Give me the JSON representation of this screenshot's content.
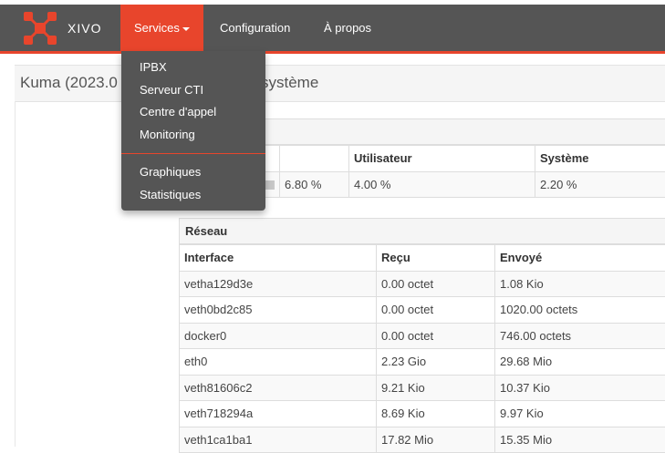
{
  "brand": {
    "name": "XIVO",
    "accent": "#e8452c",
    "navbar_bg": "#555555"
  },
  "nav": {
    "services": "Services",
    "configuration": "Configuration",
    "about": "À propos"
  },
  "dropdown": {
    "items": [
      "IPBX",
      "Serveur CTI",
      "Centre d'appel",
      "Monitoring"
    ],
    "items2": [
      "Graphiques",
      "Statistiques"
    ]
  },
  "page": {
    "title": "Kuma (2023.0",
    "title_tail": "système"
  },
  "cpu": {
    "headers": [
      "",
      "",
      "Utilisateur",
      "Système"
    ],
    "row": {
      "total": "6.80 %",
      "user": "4.00 %",
      "system": "2.20 %",
      "usage_fraction": 0.068
    }
  },
  "network": {
    "title": "Réseau",
    "headers": [
      "Interface",
      "Reçu",
      "Envoyé"
    ],
    "rows": [
      [
        "vetha129d3e",
        "0.00 octet",
        "1.08 Kio"
      ],
      [
        "veth0bd2c85",
        "0.00 octet",
        "1020.00 octets"
      ],
      [
        "docker0",
        "0.00 octet",
        "746.00 octets"
      ],
      [
        "eth0",
        "2.23 Gio",
        "29.68 Mio"
      ],
      [
        "veth81606c2",
        "9.21 Kio",
        "10.37 Kio"
      ],
      [
        "veth718294a",
        "8.69 Kio",
        "9.97 Kio"
      ],
      [
        "veth1ca1ba1",
        "17.82 Mio",
        "15.35 Mio"
      ]
    ]
  }
}
